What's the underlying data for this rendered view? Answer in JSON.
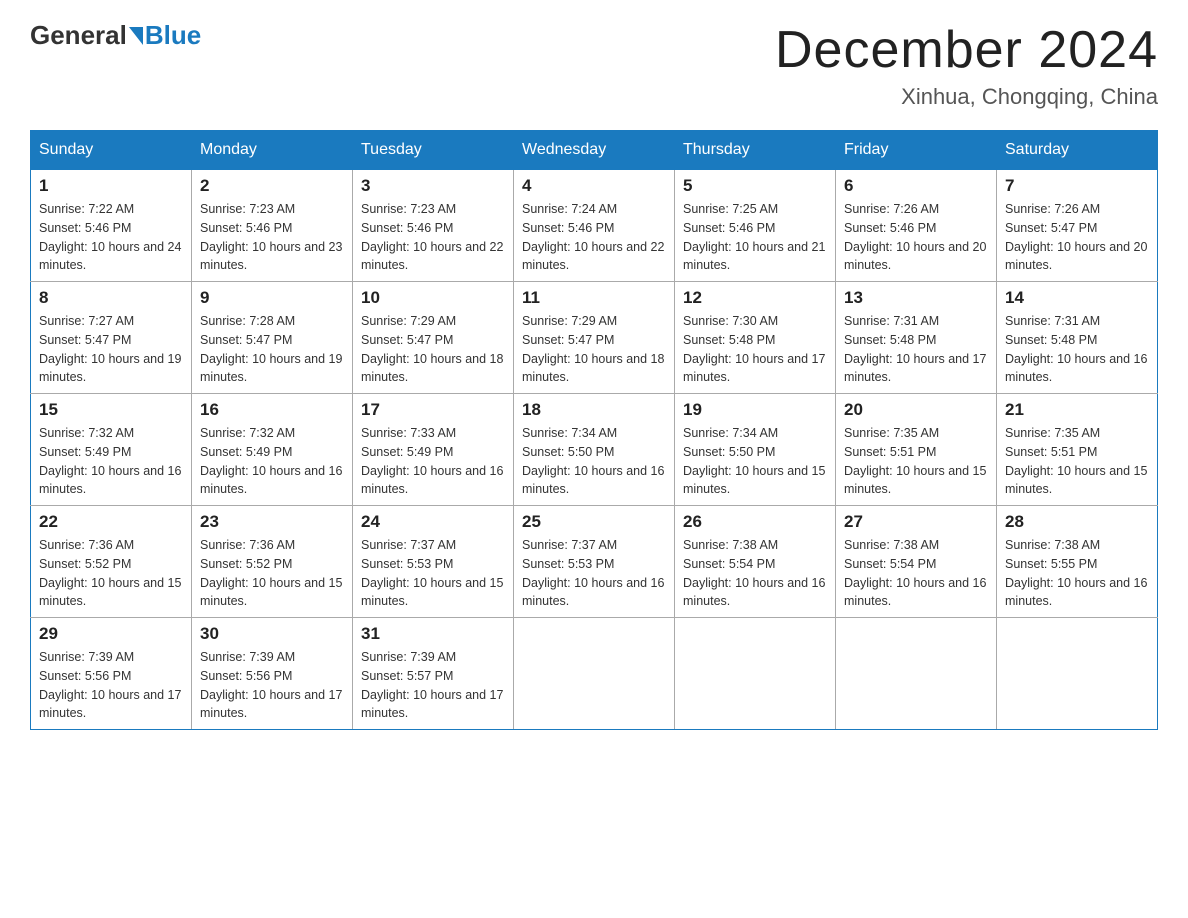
{
  "logo": {
    "general": "General",
    "blue": "Blue"
  },
  "header": {
    "title": "December 2024",
    "subtitle": "Xinhua, Chongqing, China"
  },
  "days_of_week": [
    "Sunday",
    "Monday",
    "Tuesday",
    "Wednesday",
    "Thursday",
    "Friday",
    "Saturday"
  ],
  "weeks": [
    [
      {
        "day": 1,
        "sunrise": "7:22 AM",
        "sunset": "5:46 PM",
        "daylight": "10 hours and 24 minutes."
      },
      {
        "day": 2,
        "sunrise": "7:23 AM",
        "sunset": "5:46 PM",
        "daylight": "10 hours and 23 minutes."
      },
      {
        "day": 3,
        "sunrise": "7:23 AM",
        "sunset": "5:46 PM",
        "daylight": "10 hours and 22 minutes."
      },
      {
        "day": 4,
        "sunrise": "7:24 AM",
        "sunset": "5:46 PM",
        "daylight": "10 hours and 22 minutes."
      },
      {
        "day": 5,
        "sunrise": "7:25 AM",
        "sunset": "5:46 PM",
        "daylight": "10 hours and 21 minutes."
      },
      {
        "day": 6,
        "sunrise": "7:26 AM",
        "sunset": "5:46 PM",
        "daylight": "10 hours and 20 minutes."
      },
      {
        "day": 7,
        "sunrise": "7:26 AM",
        "sunset": "5:47 PM",
        "daylight": "10 hours and 20 minutes."
      }
    ],
    [
      {
        "day": 8,
        "sunrise": "7:27 AM",
        "sunset": "5:47 PM",
        "daylight": "10 hours and 19 minutes."
      },
      {
        "day": 9,
        "sunrise": "7:28 AM",
        "sunset": "5:47 PM",
        "daylight": "10 hours and 19 minutes."
      },
      {
        "day": 10,
        "sunrise": "7:29 AM",
        "sunset": "5:47 PM",
        "daylight": "10 hours and 18 minutes."
      },
      {
        "day": 11,
        "sunrise": "7:29 AM",
        "sunset": "5:47 PM",
        "daylight": "10 hours and 18 minutes."
      },
      {
        "day": 12,
        "sunrise": "7:30 AM",
        "sunset": "5:48 PM",
        "daylight": "10 hours and 17 minutes."
      },
      {
        "day": 13,
        "sunrise": "7:31 AM",
        "sunset": "5:48 PM",
        "daylight": "10 hours and 17 minutes."
      },
      {
        "day": 14,
        "sunrise": "7:31 AM",
        "sunset": "5:48 PM",
        "daylight": "10 hours and 16 minutes."
      }
    ],
    [
      {
        "day": 15,
        "sunrise": "7:32 AM",
        "sunset": "5:49 PM",
        "daylight": "10 hours and 16 minutes."
      },
      {
        "day": 16,
        "sunrise": "7:32 AM",
        "sunset": "5:49 PM",
        "daylight": "10 hours and 16 minutes."
      },
      {
        "day": 17,
        "sunrise": "7:33 AM",
        "sunset": "5:49 PM",
        "daylight": "10 hours and 16 minutes."
      },
      {
        "day": 18,
        "sunrise": "7:34 AM",
        "sunset": "5:50 PM",
        "daylight": "10 hours and 16 minutes."
      },
      {
        "day": 19,
        "sunrise": "7:34 AM",
        "sunset": "5:50 PM",
        "daylight": "10 hours and 15 minutes."
      },
      {
        "day": 20,
        "sunrise": "7:35 AM",
        "sunset": "5:51 PM",
        "daylight": "10 hours and 15 minutes."
      },
      {
        "day": 21,
        "sunrise": "7:35 AM",
        "sunset": "5:51 PM",
        "daylight": "10 hours and 15 minutes."
      }
    ],
    [
      {
        "day": 22,
        "sunrise": "7:36 AM",
        "sunset": "5:52 PM",
        "daylight": "10 hours and 15 minutes."
      },
      {
        "day": 23,
        "sunrise": "7:36 AM",
        "sunset": "5:52 PM",
        "daylight": "10 hours and 15 minutes."
      },
      {
        "day": 24,
        "sunrise": "7:37 AM",
        "sunset": "5:53 PM",
        "daylight": "10 hours and 15 minutes."
      },
      {
        "day": 25,
        "sunrise": "7:37 AM",
        "sunset": "5:53 PM",
        "daylight": "10 hours and 16 minutes."
      },
      {
        "day": 26,
        "sunrise": "7:38 AM",
        "sunset": "5:54 PM",
        "daylight": "10 hours and 16 minutes."
      },
      {
        "day": 27,
        "sunrise": "7:38 AM",
        "sunset": "5:54 PM",
        "daylight": "10 hours and 16 minutes."
      },
      {
        "day": 28,
        "sunrise": "7:38 AM",
        "sunset": "5:55 PM",
        "daylight": "10 hours and 16 minutes."
      }
    ],
    [
      {
        "day": 29,
        "sunrise": "7:39 AM",
        "sunset": "5:56 PM",
        "daylight": "10 hours and 17 minutes."
      },
      {
        "day": 30,
        "sunrise": "7:39 AM",
        "sunset": "5:56 PM",
        "daylight": "10 hours and 17 minutes."
      },
      {
        "day": 31,
        "sunrise": "7:39 AM",
        "sunset": "5:57 PM",
        "daylight": "10 hours and 17 minutes."
      },
      null,
      null,
      null,
      null
    ]
  ]
}
